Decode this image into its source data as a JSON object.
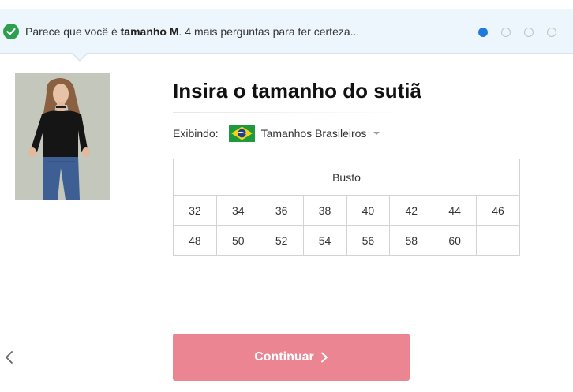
{
  "banner": {
    "prefix": "Parece que você é ",
    "size": "tamanho M",
    "suffix": ". 4 mais perguntas para ter certeza...",
    "steps_total": 4,
    "step_active": 1
  },
  "page": {
    "title": "Insira o tamanho do sutiã",
    "showing_label": "Exibindo:",
    "size_system": "Tamanhos Brasileiros"
  },
  "table": {
    "header": "Busto",
    "rows": [
      [
        "32",
        "34",
        "36",
        "38",
        "40",
        "42",
        "44",
        "46"
      ],
      [
        "48",
        "50",
        "52",
        "54",
        "56",
        "58",
        "60",
        ""
      ]
    ]
  },
  "actions": {
    "continue_label": "Continuar"
  },
  "colors": {
    "accent": "#1f7ae0",
    "button": "#ea8591",
    "check": "#2e9e4f"
  }
}
